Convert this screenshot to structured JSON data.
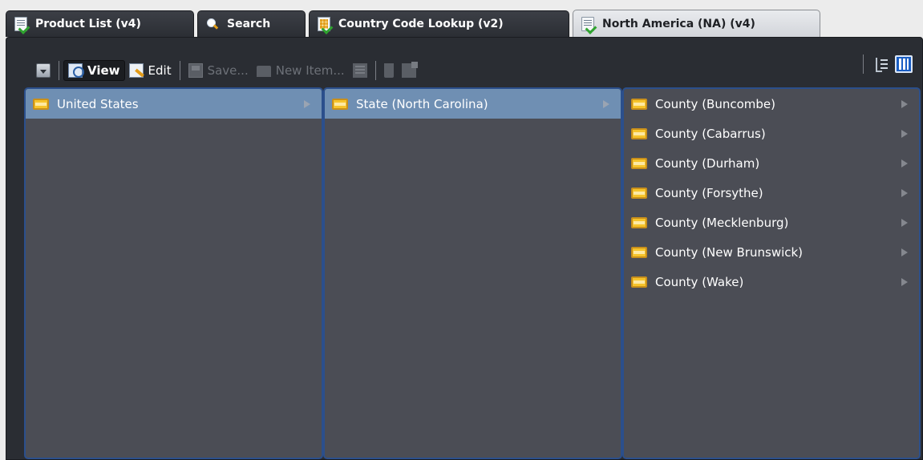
{
  "tabs": [
    {
      "label": "Product List (v4)",
      "icon": "document-check-icon"
    },
    {
      "label": "Search",
      "icon": "search-icon"
    },
    {
      "label": "Country Code Lookup (v2)",
      "icon": "grid-document-icon"
    },
    {
      "label": "North America (NA) (v4)",
      "icon": "document-check-icon",
      "active": true
    }
  ],
  "toolbar": {
    "view_label": "View",
    "edit_label": "Edit",
    "save_label": "Save...",
    "new_item_label": "New Item..."
  },
  "columns": [
    {
      "items": [
        {
          "label": "United States",
          "selected": true
        }
      ]
    },
    {
      "items": [
        {
          "label": "State (North Carolina)",
          "selected": true
        }
      ]
    },
    {
      "items": [
        {
          "label": "County (Buncombe)"
        },
        {
          "label": "County (Cabarrus)"
        },
        {
          "label": "County (Durham)"
        },
        {
          "label": "County (Forsythe)"
        },
        {
          "label": "County (Mecklenburg)"
        },
        {
          "label": "County (New Brunswick)"
        },
        {
          "label": "County (Wake)"
        }
      ]
    }
  ],
  "colors": {
    "selection": "#6f8fb3",
    "column_bg": "#4b4d55",
    "column_border": "#2b4f8c",
    "folder": "#f6c42b"
  }
}
